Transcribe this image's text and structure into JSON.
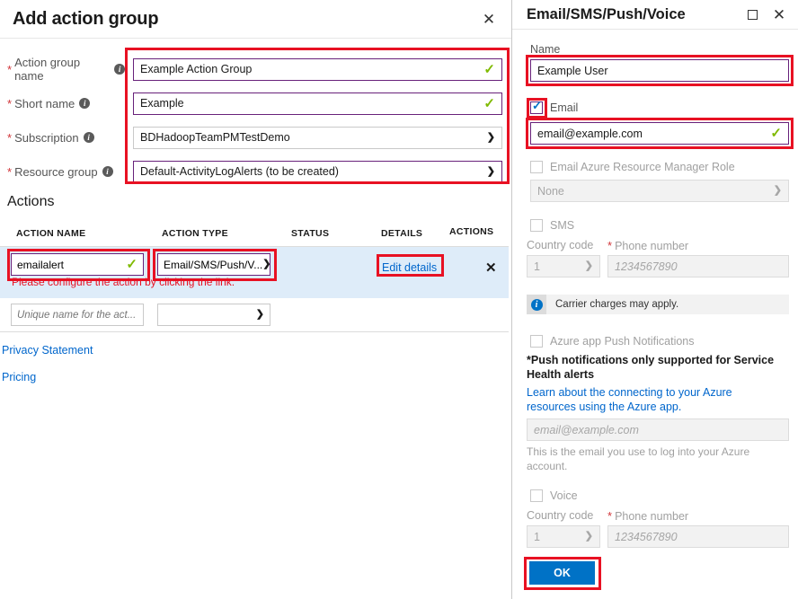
{
  "left_panel": {
    "title": "Add action group",
    "close_icon": "✕",
    "fields": [
      {
        "label": "Action group name",
        "required": true,
        "info": true,
        "value": "Example Action Group",
        "state": "valid",
        "type": "text"
      },
      {
        "label": "Short name",
        "required": true,
        "info": true,
        "value": "Example",
        "state": "valid",
        "type": "text"
      },
      {
        "label": "Subscription",
        "required": true,
        "info": true,
        "value": "BDHadoopTeamPMTestDemo",
        "state": "normal",
        "type": "select"
      },
      {
        "label": "Resource group",
        "required": true,
        "info": true,
        "value": "Default-ActivityLogAlerts (to be created)",
        "state": "normal",
        "type": "select"
      }
    ],
    "actions_heading": "Actions",
    "table": {
      "columns": [
        "ACTION NAME",
        "ACTION TYPE",
        "STATUS",
        "DETAILS",
        "ACTIONS"
      ],
      "rows": [
        {
          "action_name": "emailalert",
          "action_type": "Email/SMS/Push/V...",
          "status": "",
          "details_link": "Edit details",
          "remove_icon": "✕",
          "error": "Please configure the action by clicking the link."
        },
        {
          "action_name_placeholder": "Unique name for the act...",
          "action_type": ""
        }
      ]
    },
    "links": [
      {
        "label": "Privacy Statement"
      },
      {
        "label": "Pricing"
      }
    ]
  },
  "right_panel": {
    "title": "Email/SMS/Push/Voice",
    "maximize_icon": "maximize",
    "close_icon": "✕",
    "name_label": "Name",
    "name_value": "Example User",
    "email": {
      "checkbox_label": "Email",
      "checked": true,
      "value": "email@example.com",
      "valid": true
    },
    "arm_role": {
      "checkbox_label": "Email Azure Resource Manager Role",
      "checked": false,
      "select_value": "None"
    },
    "sms": {
      "checkbox_label": "SMS",
      "checked": false,
      "country_code_label": "Country code",
      "country_code_value": "1",
      "phone_label": "Phone number",
      "phone_required": true,
      "phone_placeholder": "1234567890"
    },
    "carrier_notice": {
      "icon": "info-icon",
      "text": "Carrier charges may apply."
    },
    "push": {
      "checkbox_label": "Azure app Push Notifications",
      "checked": false,
      "note_line1": "*Push notifications only supported for Service",
      "note_line2": "Health alerts",
      "link_line1": "Learn about the connecting to your Azure",
      "link_line2": "resources using the Azure app.",
      "email_placeholder": "email@example.com",
      "help_line1": "This is the email you use to log into your Azure",
      "help_line2": "account."
    },
    "voice": {
      "checkbox_label": "Voice",
      "checked": false,
      "country_code_label": "Country code",
      "country_code_value": "1",
      "phone_label": "Phone number",
      "phone_required": true,
      "phone_placeholder": "1234567890"
    },
    "ok_button": "OK"
  },
  "colors": {
    "accent_blue": "#0072c6",
    "link_blue": "#0066cc",
    "purple_border": "#68217a",
    "valid_green": "#7fba00",
    "error_red": "#e81123",
    "highlight_row": "#deecf9",
    "annotation_red": "#e81123"
  }
}
